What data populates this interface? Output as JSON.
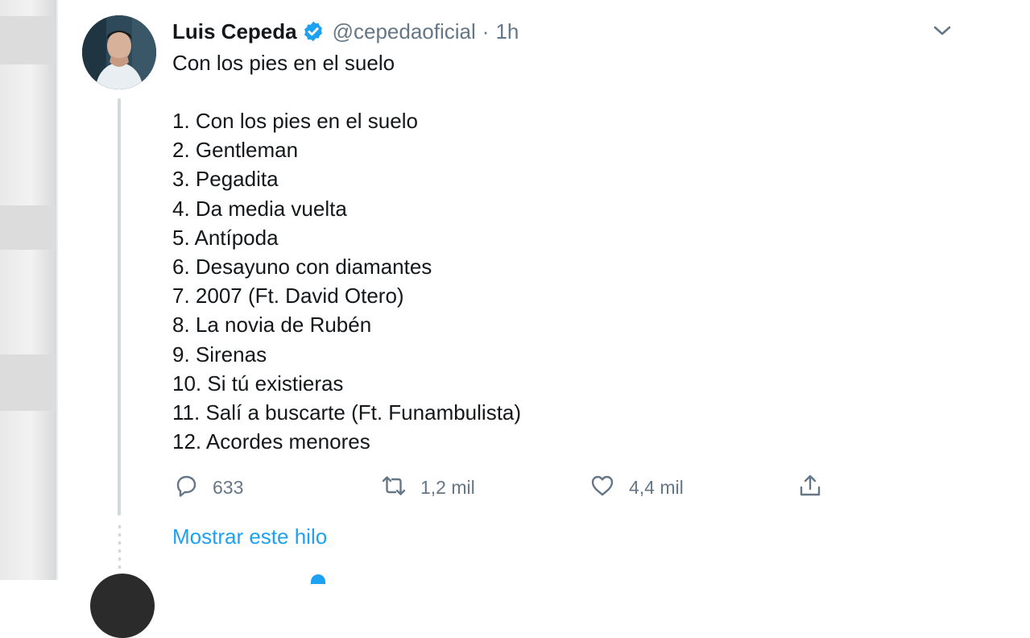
{
  "tweet": {
    "author_name": "Luis Cepeda",
    "handle": "@cepedaoficial",
    "separator": "·",
    "time": "1h",
    "title": "Con los pies en el suelo",
    "tracks": [
      "1. Con los pies en el suelo",
      "2. Gentleman",
      "3. Pegadita",
      "4. Da media vuelta",
      "5. Antípoda",
      "6. Desayuno con diamantes",
      "7. 2007 (Ft. David Otero)",
      "8. La novia de Rubén",
      "9. Sirenas",
      "10. Si tú existieras",
      "11. Salí a buscarte (Ft. Funambulista)",
      "12. Acordes menores"
    ],
    "replies": "633",
    "retweets": "1,2 mil",
    "likes": "4,4 mil",
    "show_thread": "Mostrar este hilo"
  },
  "icons": {
    "verified": "verified-badge-icon",
    "menu": "chevron-down-icon",
    "reply": "reply-icon",
    "retweet": "retweet-icon",
    "like": "heart-icon",
    "share": "share-icon"
  },
  "colors": {
    "accent": "#1da1f2",
    "secondary_text": "#657786",
    "primary_text": "#14171a",
    "thread_line": "#cfd9de"
  }
}
